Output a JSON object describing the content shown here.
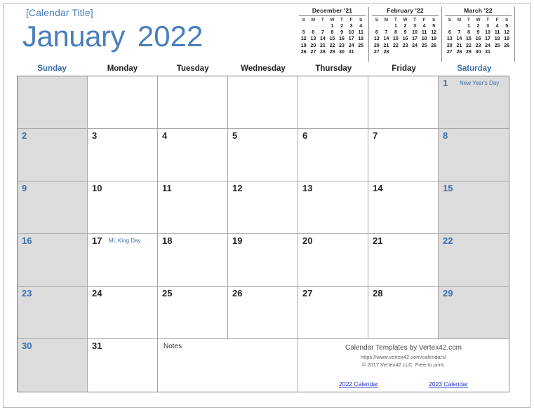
{
  "header": {
    "calendar_title": "[Calendar Title]",
    "month_name": "January",
    "year": "2022",
    "title_color": "#4a7ebb"
  },
  "mini_calendars": [
    {
      "title": "December '21",
      "dow": [
        "S",
        "M",
        "T",
        "W",
        "T",
        "F",
        "S"
      ],
      "weeks": [
        [
          "",
          "",
          "",
          "1",
          "2",
          "3",
          "4"
        ],
        [
          "5",
          "6",
          "7",
          "8",
          "9",
          "10",
          "11"
        ],
        [
          "12",
          "13",
          "14",
          "15",
          "16",
          "17",
          "18"
        ],
        [
          "19",
          "20",
          "21",
          "22",
          "23",
          "24",
          "25"
        ],
        [
          "26",
          "27",
          "28",
          "29",
          "30",
          "31",
          ""
        ]
      ]
    },
    {
      "title": "February '22",
      "dow": [
        "S",
        "M",
        "T",
        "W",
        "T",
        "F",
        "S"
      ],
      "weeks": [
        [
          "",
          "",
          "1",
          "2",
          "3",
          "4",
          "5"
        ],
        [
          "6",
          "7",
          "8",
          "9",
          "10",
          "11",
          "12"
        ],
        [
          "13",
          "14",
          "15",
          "16",
          "17",
          "18",
          "19"
        ],
        [
          "20",
          "21",
          "22",
          "23",
          "24",
          "25",
          "26"
        ],
        [
          "27",
          "28",
          "",
          "",
          "",
          "",
          ""
        ]
      ]
    },
    {
      "title": "March '22",
      "dow": [
        "S",
        "M",
        "T",
        "W",
        "T",
        "F",
        "S"
      ],
      "weeks": [
        [
          "",
          "",
          "1",
          "2",
          "3",
          "4",
          "5"
        ],
        [
          "6",
          "7",
          "8",
          "9",
          "10",
          "11",
          "12"
        ],
        [
          "13",
          "14",
          "15",
          "16",
          "17",
          "18",
          "19"
        ],
        [
          "20",
          "21",
          "22",
          "23",
          "24",
          "25",
          "26"
        ],
        [
          "27",
          "28",
          "29",
          "30",
          "31",
          "",
          ""
        ]
      ]
    }
  ],
  "weekday_headers": [
    {
      "label": "Sunday",
      "weekend": true
    },
    {
      "label": "Monday",
      "weekend": false
    },
    {
      "label": "Tuesday",
      "weekend": false
    },
    {
      "label": "Wednesday",
      "weekend": false
    },
    {
      "label": "Thursday",
      "weekend": false
    },
    {
      "label": "Friday",
      "weekend": false
    },
    {
      "label": "Saturday",
      "weekend": true
    }
  ],
  "grid": {
    "weeks": [
      [
        {
          "day": "",
          "shaded": true,
          "event": ""
        },
        {
          "day": "",
          "shaded": false,
          "event": ""
        },
        {
          "day": "",
          "shaded": false,
          "event": ""
        },
        {
          "day": "",
          "shaded": false,
          "event": ""
        },
        {
          "day": "",
          "shaded": false,
          "event": ""
        },
        {
          "day": "",
          "shaded": false,
          "event": ""
        },
        {
          "day": "1",
          "shaded": true,
          "event": "New Year's Day"
        }
      ],
      [
        {
          "day": "2",
          "shaded": true,
          "event": ""
        },
        {
          "day": "3",
          "shaded": false,
          "event": ""
        },
        {
          "day": "4",
          "shaded": false,
          "event": ""
        },
        {
          "day": "5",
          "shaded": false,
          "event": ""
        },
        {
          "day": "6",
          "shaded": false,
          "event": ""
        },
        {
          "day": "7",
          "shaded": false,
          "event": ""
        },
        {
          "day": "8",
          "shaded": true,
          "event": ""
        }
      ],
      [
        {
          "day": "9",
          "shaded": true,
          "event": ""
        },
        {
          "day": "10",
          "shaded": false,
          "event": ""
        },
        {
          "day": "11",
          "shaded": false,
          "event": ""
        },
        {
          "day": "12",
          "shaded": false,
          "event": ""
        },
        {
          "day": "13",
          "shaded": false,
          "event": ""
        },
        {
          "day": "14",
          "shaded": false,
          "event": ""
        },
        {
          "day": "15",
          "shaded": true,
          "event": ""
        }
      ],
      [
        {
          "day": "16",
          "shaded": true,
          "event": ""
        },
        {
          "day": "17",
          "shaded": false,
          "event": "ML King Day"
        },
        {
          "day": "18",
          "shaded": false,
          "event": ""
        },
        {
          "day": "19",
          "shaded": false,
          "event": ""
        },
        {
          "day": "20",
          "shaded": false,
          "event": ""
        },
        {
          "day": "21",
          "shaded": false,
          "event": ""
        },
        {
          "day": "22",
          "shaded": true,
          "event": ""
        }
      ],
      [
        {
          "day": "23",
          "shaded": true,
          "event": ""
        },
        {
          "day": "24",
          "shaded": false,
          "event": ""
        },
        {
          "day": "25",
          "shaded": false,
          "event": ""
        },
        {
          "day": "26",
          "shaded": false,
          "event": ""
        },
        {
          "day": "27",
          "shaded": false,
          "event": ""
        },
        {
          "day": "28",
          "shaded": false,
          "event": ""
        },
        {
          "day": "29",
          "shaded": true,
          "event": ""
        }
      ],
      [
        {
          "day": "30",
          "shaded": true,
          "event": ""
        },
        {
          "day": "31",
          "shaded": false,
          "event": ""
        }
      ]
    ],
    "notes_label": "Notes"
  },
  "footer": {
    "credit_line_1": "Calendar Templates by Vertex42.com",
    "credit_line_2": "https://www.vertex42.com/calendars/",
    "credit_line_3": "© 2017 Vertex42 LLC. Free to print.",
    "link_prev": "2022 Calendar",
    "link_next": "2023 Calendar"
  },
  "colors": {
    "accent_blue": "#4a7ebb",
    "weekend_blue": "#3c6fb0",
    "shade_gray": "#dcdcdc",
    "link_blue": "#2233cc"
  }
}
